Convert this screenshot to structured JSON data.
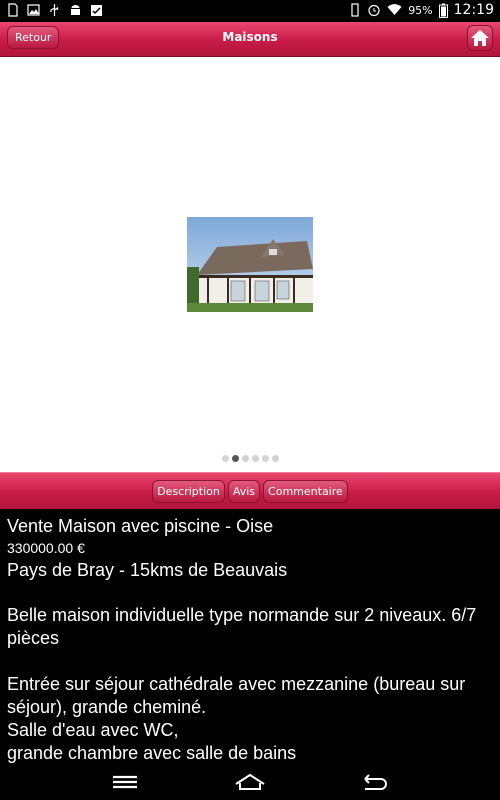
{
  "statusbar": {
    "battery": "95%",
    "time": "12:19"
  },
  "header": {
    "back_label": "Retour",
    "title": "Maisons"
  },
  "gallery": {
    "slide_count": 6,
    "active_index": 1
  },
  "tabs": [
    {
      "label": "Description"
    },
    {
      "label": "Avis"
    },
    {
      "label": "Commentaire"
    }
  ],
  "listing": {
    "title": "Vente Maison avec piscine - Oise",
    "price": "330000.00 €",
    "location": "Pays de Bray - 15kms de Beauvais",
    "paragraph1": "Belle maison individuelle type normande sur 2 niveaux. 6/7 pièces",
    "paragraph2": "Entrée sur séjour cathédrale avec mezzanine (bureau sur séjour), grande cheminé.\nSalle d'eau avec WC,\ngrande chambre avec salle de bains"
  },
  "colors": {
    "header_red": "#c81b47",
    "content_bg": "#000000"
  },
  "icons": [
    "home-icon",
    "menu-icon",
    "home-nav-icon",
    "back-nav-icon"
  ]
}
